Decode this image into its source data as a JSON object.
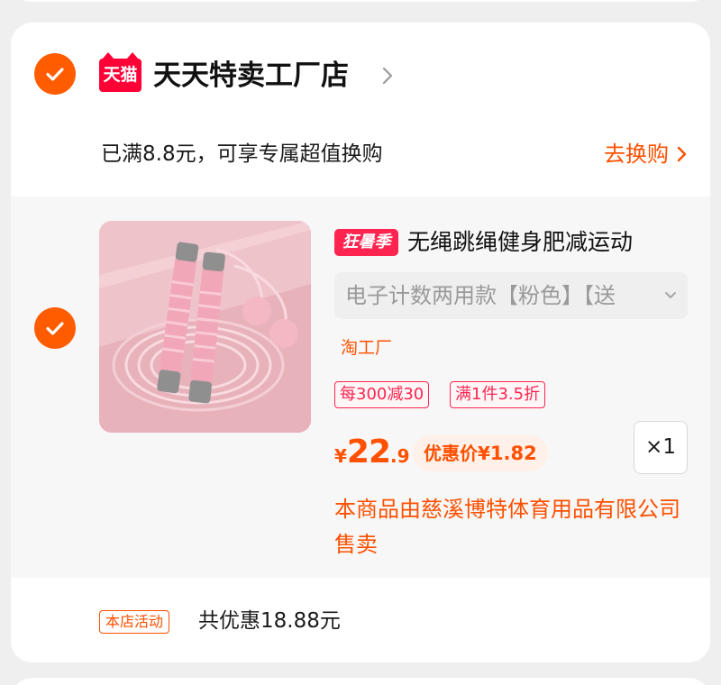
{
  "shop": {
    "badge": "天猫",
    "name": "天天特卖工厂店"
  },
  "promo": {
    "text": "已满8.8元，可享专属超值换购",
    "action": "去换购"
  },
  "item": {
    "tag": "狂暑季",
    "title": "无绳跳绳健身肥减运动",
    "sku": "电子计数两用款【粉色】【送",
    "factory_tag": "淘工厂",
    "coupons": [
      "每300减30",
      "满1件3.5折"
    ],
    "price_symbol": "¥",
    "price_int": "22",
    "price_dec": ".9",
    "discount_label": "优惠价",
    "discount_symbol": "¥",
    "discount_value": "1.82",
    "quantity": "×1",
    "seller_note": "本商品由慈溪博特体育用品有限公司售卖"
  },
  "footer": {
    "activity_badge": "本店活动",
    "total_discount": "共优惠18.88元"
  },
  "colors": {
    "accent": "#ff5000",
    "tmall_red": "#ff0036",
    "tag_red": "#ff2550"
  },
  "icons": {
    "shop_check": "check-circle-icon",
    "item_check": "check-circle-icon",
    "shop_arrow": "chevron-right-icon",
    "sku_arrow": "chevron-down-icon"
  }
}
